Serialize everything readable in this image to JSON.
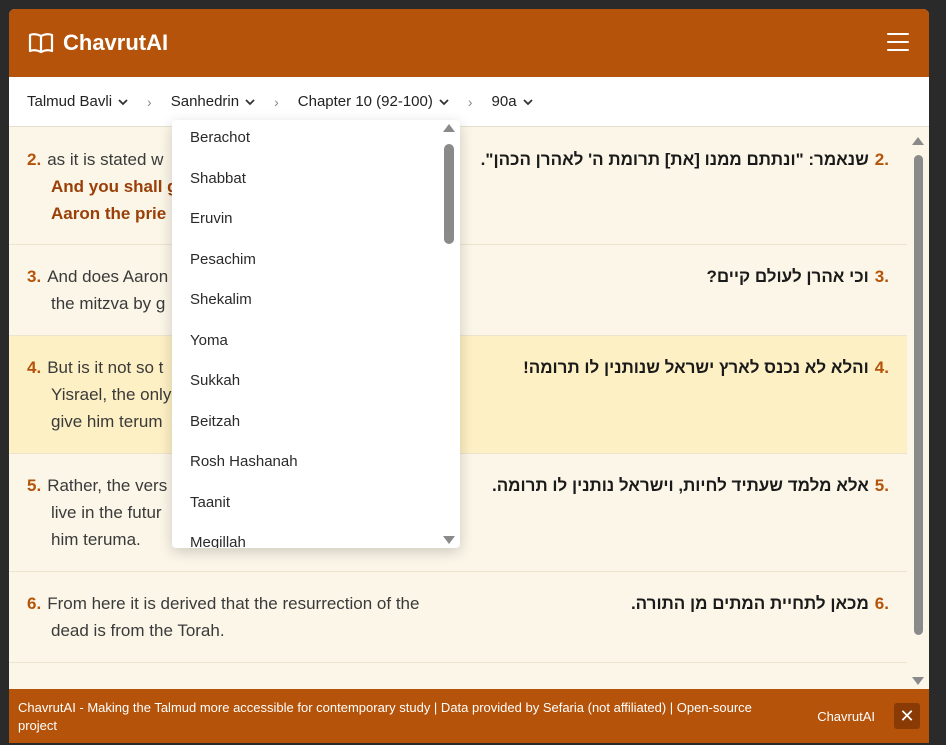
{
  "header": {
    "title": "ChavrutAI",
    "logo_icon": "open-book-icon",
    "menu_icon": "hamburger-icon"
  },
  "breadcrumb": {
    "corpus": "Talmud Bavli",
    "tractate": "Sanhedrin",
    "chapter": "Chapter 10 (92-100)",
    "page": "90a"
  },
  "rows": [
    {
      "num": "2.",
      "en_text": "as it is stated w",
      "en_bold": "And you shall g",
      "en_bold2": "Aaron the prie",
      "he_num": ".2",
      "he_text": "שנאמר: \"ונתתם ממנו [את] תרומת ה' לאהרן הכהן\"."
    },
    {
      "num": "3.",
      "en_text": "And does Aaron",
      "en_text2": "the mitzva by g",
      "he_num": ".3",
      "he_text": "וכי אהרן לעולם קיים?"
    },
    {
      "num": "4.",
      "en_text": "But is it not so t",
      "en_text2": "Yisrael, the only",
      "en_text3": "give him terum",
      "he_num": ".4",
      "he_text": "והלא לא נכנס לארץ ישראל שנותנין לו תרומה!"
    },
    {
      "num": "5.",
      "en_text": "Rather, the vers",
      "en_text2": "live in the futur",
      "en_text3": "him teruma.",
      "he_num": ".5",
      "he_text": "אלא מלמד שעתיד לחיות, וישראל נותנין לו תרומה."
    },
    {
      "num": "6.",
      "en_text": "From here it is derived that the resurrection of the",
      "en_text2": "dead is from the Torah.",
      "he_num": ".6",
      "he_text": "מכאן לתחיית המתים מן התורה."
    }
  ],
  "dropdown": {
    "items": [
      "Berachot",
      "Shabbat",
      "Eruvin",
      "Pesachim",
      "Shekalim",
      "Yoma",
      "Sukkah",
      "Beitzah",
      "Rosh Hashanah",
      "Taanit",
      "Megillah"
    ]
  },
  "footer": {
    "text": "ChavrutAI - Making the Talmud more accessible for contemporary study | Data provided by Sefaria (not affiliated) | Open-source project",
    "brand": "ChavrutAI",
    "close_label": "✕"
  },
  "colors": {
    "accent": "#b45309",
    "background": "#fbf6e8",
    "active_row": "#fdf0c4"
  }
}
